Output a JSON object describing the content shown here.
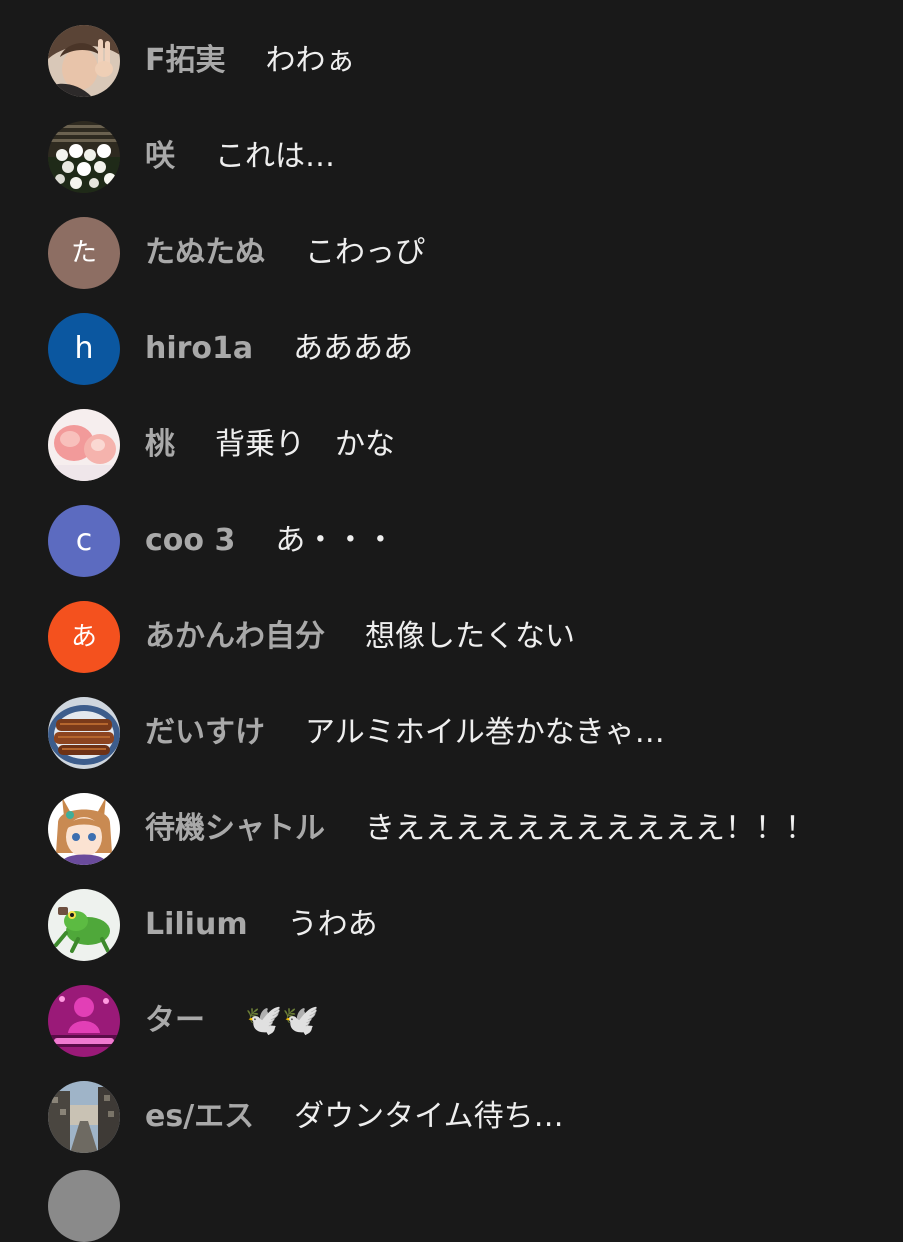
{
  "colors": {
    "background": "#191919",
    "author_text": "#a9a9a9",
    "message_text": "#eeeeee"
  },
  "chat": {
    "messages": [
      {
        "author": "F拓実",
        "message": "わわぁ",
        "avatar": {
          "type": "photo",
          "icon": "person-peace-sign-photo"
        }
      },
      {
        "author": "咲",
        "message": "これは…",
        "avatar": {
          "type": "photo",
          "icon": "white-flowers-photo"
        }
      },
      {
        "author": "たぬたぬ",
        "message": "こわっぴ",
        "avatar": {
          "type": "initial",
          "letter": "た",
          "color": "#8d6e63"
        }
      },
      {
        "author": "hiro1a",
        "message": "ああああ",
        "avatar": {
          "type": "initial",
          "letter": "h",
          "color": "#0b57a0"
        }
      },
      {
        "author": "桃",
        "message": "背乗り　かな",
        "avatar": {
          "type": "photo",
          "icon": "peach-photo"
        }
      },
      {
        "author": "coo 3",
        "message": "あ・・・",
        "avatar": {
          "type": "initial",
          "letter": "c",
          "color": "#5c6bc0"
        }
      },
      {
        "author": "あかんわ自分",
        "message": "想像したくない",
        "avatar": {
          "type": "initial",
          "letter": "あ",
          "color": "#f4511e"
        }
      },
      {
        "author": "だいすけ",
        "message": "アルミホイル巻かなきゃ…",
        "avatar": {
          "type": "photo",
          "icon": "grilled-eel-photo"
        }
      },
      {
        "author": "待機シャトル",
        "message": "きえええええええええええ！！！",
        "avatar": {
          "type": "photo",
          "icon": "anime-horse-girl-photo"
        }
      },
      {
        "author": "Lilium",
        "message": "うわあ",
        "avatar": {
          "type": "photo",
          "icon": "green-frog-photo"
        }
      },
      {
        "author": "ター",
        "message": "🕊️🕊️",
        "avatar": {
          "type": "photo",
          "icon": "pink-juggler-logo-photo"
        }
      },
      {
        "author": "es/エス",
        "message": "ダウンタイム待ち…",
        "avatar": {
          "type": "photo",
          "icon": "city-street-photo"
        }
      }
    ]
  }
}
